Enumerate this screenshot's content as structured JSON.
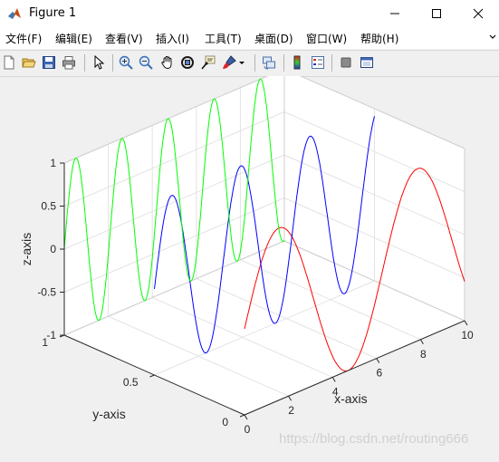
{
  "window": {
    "title": "Figure 1"
  },
  "menubar": {
    "items": [
      "文件(F)",
      "编辑(E)",
      "查看(V)",
      "插入(I)",
      "工具(T)",
      "桌面(D)",
      "窗口(W)",
      "帮助(H)"
    ]
  },
  "toolbar": {
    "icons": [
      "new-figure",
      "open-file",
      "save",
      "print",
      "edit-plot",
      "zoom-in",
      "zoom-out",
      "pan",
      "rotate-3d",
      "data-cursor",
      "brush",
      "brush-dropdown",
      "link-plot",
      "insert-colorbar",
      "insert-legend",
      "hide-plot-tools",
      "show-plot-tools"
    ]
  },
  "chart_data": {
    "type": "line",
    "projection": "3d",
    "xlabel": "x-axis",
    "ylabel": "y-axis",
    "zlabel": "z-axis",
    "xlim": [
      0,
      10
    ],
    "ylim": [
      0,
      1
    ],
    "zlim": [
      -1,
      1
    ],
    "x_ticks": [
      "0",
      "2",
      "4",
      "6",
      "8",
      "10"
    ],
    "y_ticks": [
      "0",
      "0.5",
      "1"
    ],
    "z_ticks": [
      "-1",
      "-0.5",
      "0",
      "0.5",
      "1"
    ],
    "grid": true,
    "box": "on",
    "series": [
      {
        "color": "#ff0000",
        "x_range": [
          0,
          10
        ],
        "y": 0,
        "function": "z = sin(x)"
      },
      {
        "color": "#0000ff",
        "x_range": [
          0,
          10
        ],
        "y": 0.5,
        "function": "z = sin(2x)"
      },
      {
        "color": "#00ff00",
        "x_range": [
          0,
          10
        ],
        "y": 1,
        "function": "z = sin(3x)"
      }
    ]
  },
  "watermark": "https://blog.csdn.net/routing666"
}
